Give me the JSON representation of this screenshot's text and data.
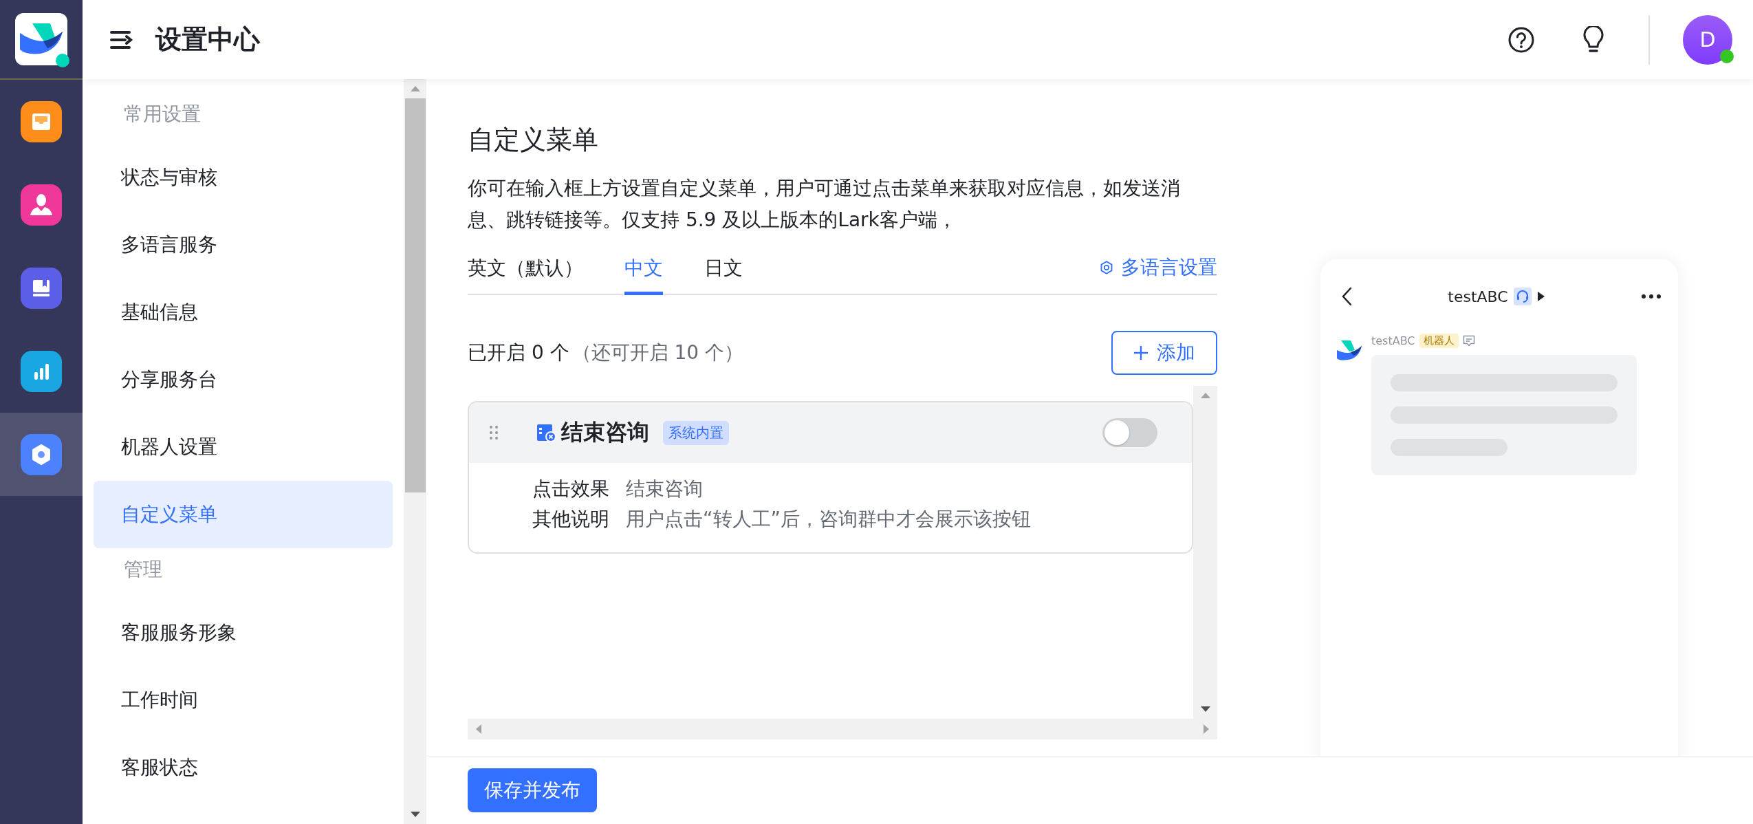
{
  "header": {
    "title": "设置中心",
    "avatar_letter": "D",
    "online": true
  },
  "rail": [
    {
      "kind": "inbox",
      "color": "#ff8d1a",
      "selected": false
    },
    {
      "kind": "agent",
      "color": "#f0379a",
      "selected": false
    },
    {
      "kind": "book",
      "color": "#5b5fe8",
      "selected": false
    },
    {
      "kind": "chart",
      "color": "#1aa6e0",
      "selected": false
    },
    {
      "kind": "settings",
      "color": "#4d82ff",
      "selected": true
    }
  ],
  "sidebar": {
    "groups": [
      {
        "heading": "常用设置",
        "items": [
          {
            "label": "状态与审核",
            "selected": false
          },
          {
            "label": "多语言服务",
            "selected": false
          },
          {
            "label": "基础信息",
            "selected": false
          },
          {
            "label": "分享服务台",
            "selected": false
          },
          {
            "label": "机器人设置",
            "selected": false
          },
          {
            "label": "自定义菜单",
            "selected": true
          }
        ]
      },
      {
        "heading": "管理",
        "items": [
          {
            "label": "客服服务形象",
            "selected": false
          },
          {
            "label": "工作时间",
            "selected": false
          },
          {
            "label": "客服状态",
            "selected": false
          }
        ]
      }
    ]
  },
  "page": {
    "title": "自定义菜单",
    "description": "你可在输入框上方设置自定义菜单，用户可通过点击菜单来获取对应信息，如发送消息、跳转链接等。仅支持 5.9 及以上版本的Lark客户端，",
    "tabs": [
      {
        "label": "英文（默认）",
        "selected": false
      },
      {
        "label": "中文",
        "selected": true
      },
      {
        "label": "日文",
        "selected": false
      }
    ],
    "language_settings": "多语言设置",
    "count": "已开启 0 个",
    "count_hint": "（还可开启 10 个）",
    "add_button": "添加",
    "menus": [
      {
        "name": "结束咨询",
        "tag": "系统内置",
        "on": false,
        "fields": [
          {
            "label": "点击效果",
            "value": "结束咨询"
          },
          {
            "label": "其他说明",
            "value": "用户点击“转人工”后，咨询群中才会展示该按钮"
          }
        ]
      }
    ]
  },
  "preview": {
    "chat_title": "testABC",
    "sender": "testABC",
    "sender_tag": "机器人"
  },
  "footer": {
    "save_button": "保存并发布"
  }
}
